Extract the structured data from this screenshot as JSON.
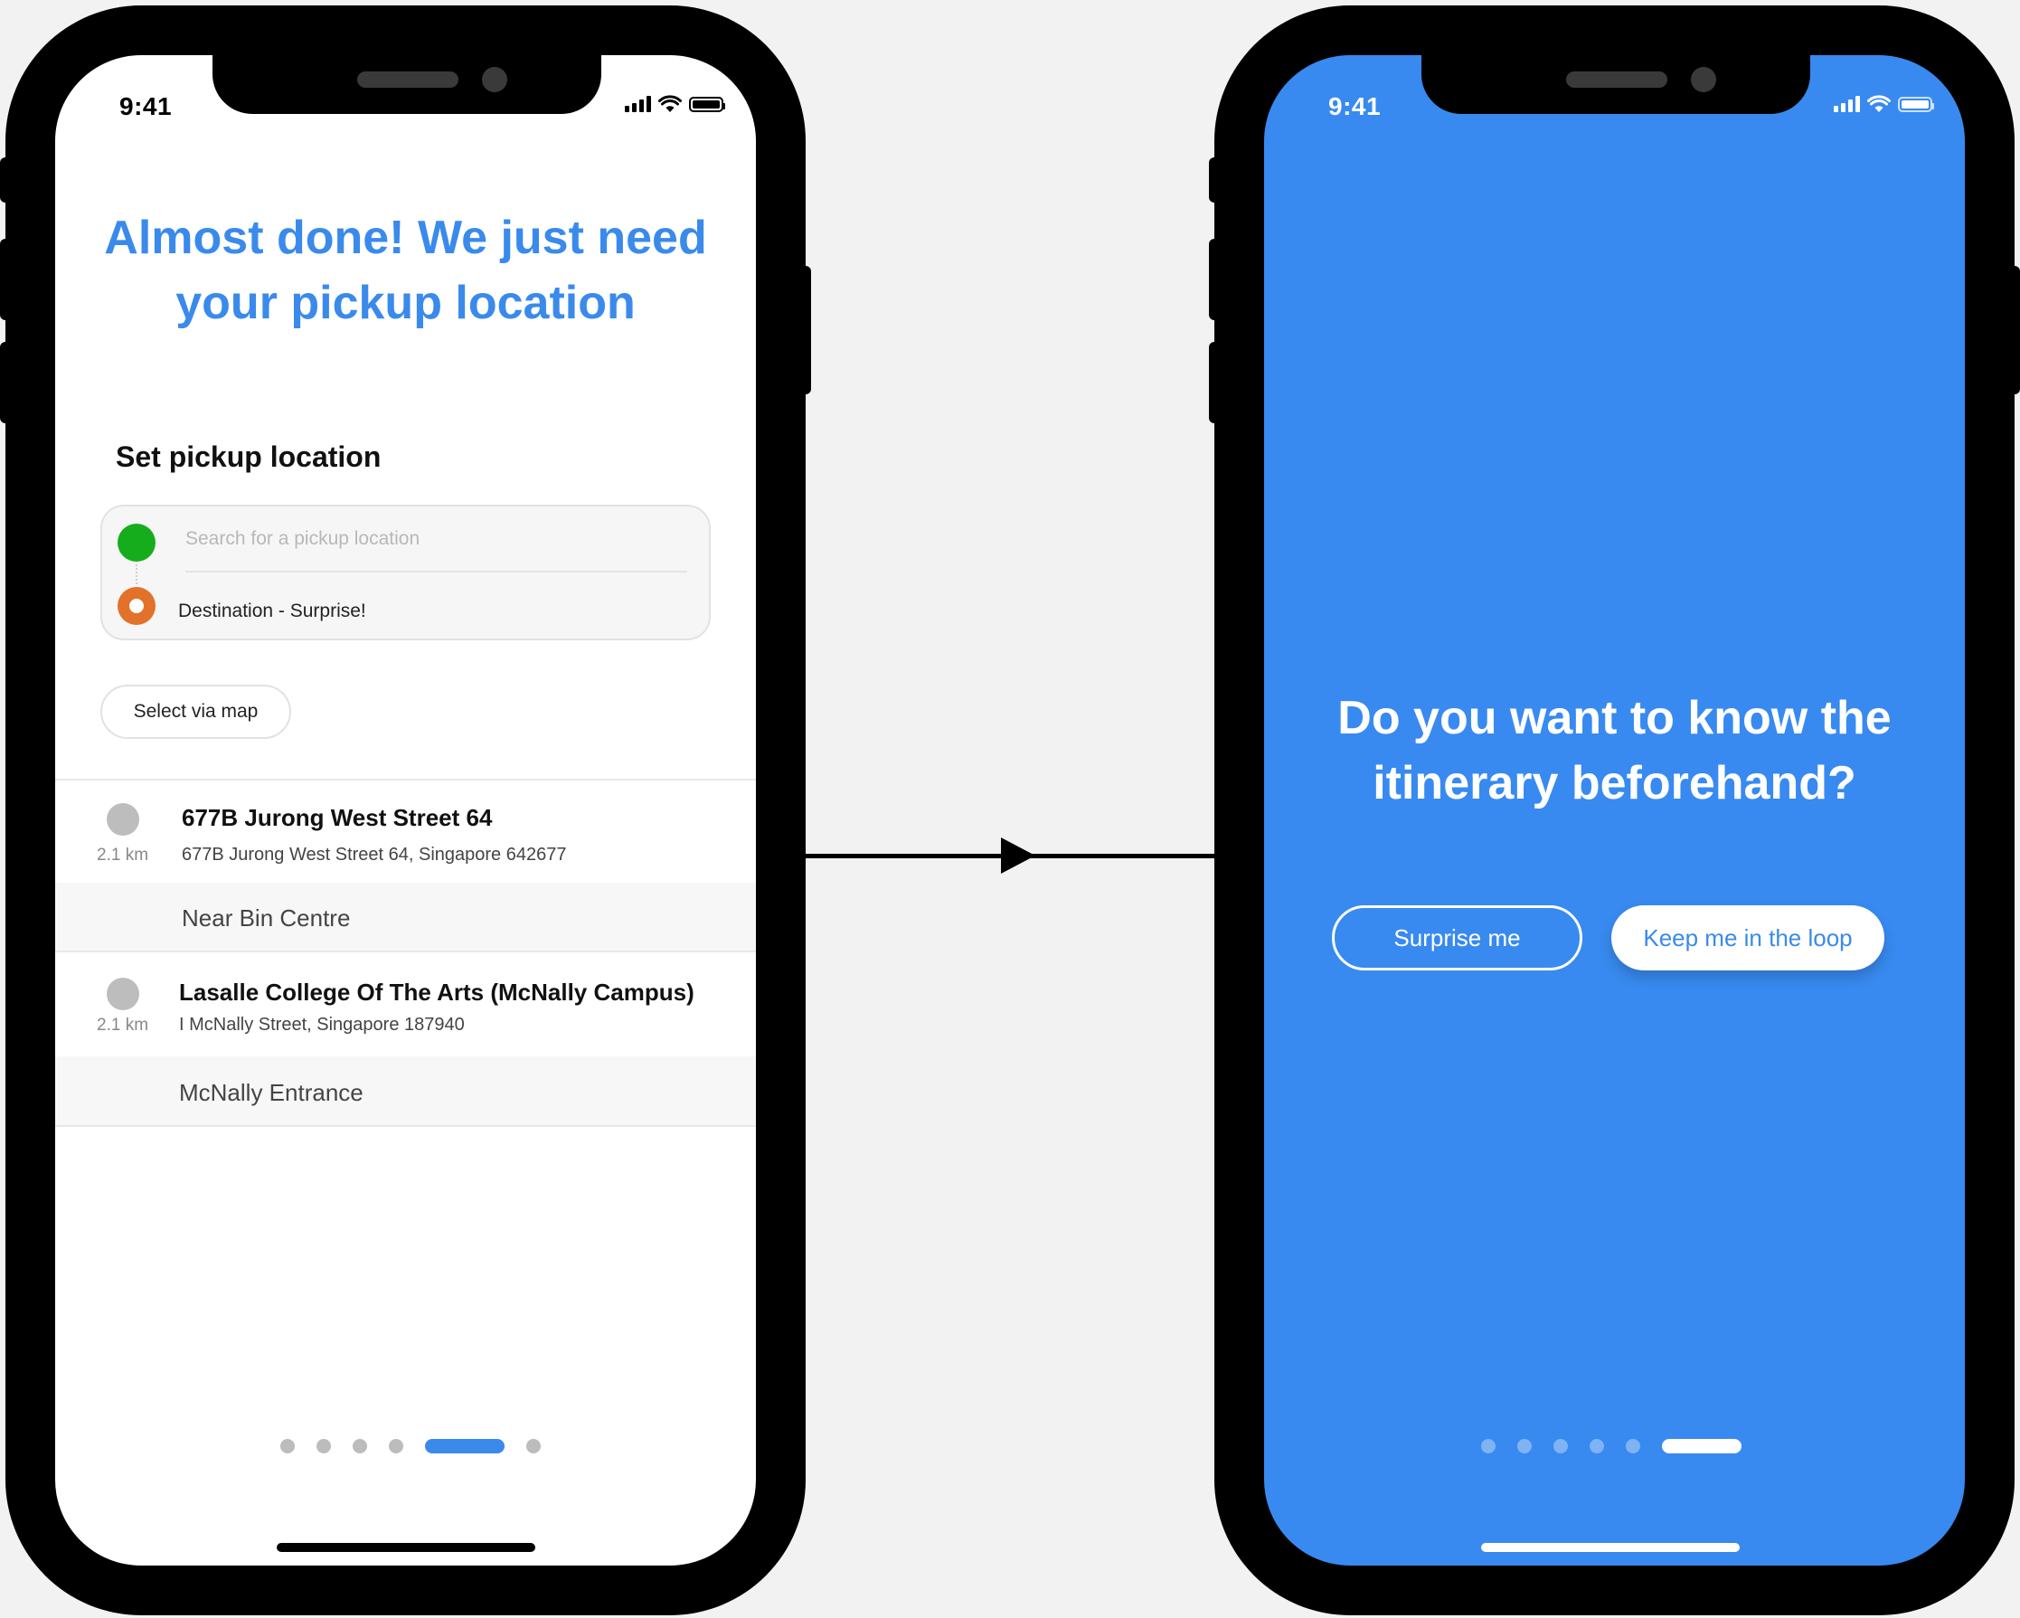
{
  "screen_left": {
    "status_time": "9:41",
    "headline": "Almost done! We just need your pickup location",
    "section_title": "Set pickup location",
    "search": {
      "placeholder": "Search for a pickup location",
      "value": ""
    },
    "destination_label": "Destination - Surprise!",
    "select_map_label": "Select via map",
    "results": [
      {
        "name": "677B Jurong West Street 64",
        "distance": "2.1 km",
        "address": "677B Jurong West Street 64, Singapore 642677",
        "sub_location": "Near Bin Centre"
      },
      {
        "name": "Lasalle College Of The Arts (McNally Campus)",
        "distance": "2.1 km",
        "address": "I McNally Street, Singapore 187940",
        "sub_location": "McNally Entrance"
      }
    ],
    "pager": {
      "total": 6,
      "active_index": 4
    }
  },
  "screen_right": {
    "status_time": "9:41",
    "question": "Do you want to know the itinerary beforehand?",
    "surprise_button": "Surprise me",
    "loop_button": "Keep me in the loop",
    "pager": {
      "total": 6,
      "active_index": 5
    }
  },
  "colors": {
    "accent_blue": "#3a8aec",
    "screen_blue": "#388af0",
    "pickup_green": "#16ad1c",
    "destination_orange": "#e2722a",
    "canvas": "#f2f2f2"
  },
  "icons": [
    "signal-icon",
    "wifi-icon",
    "battery-icon",
    "pickup-dot-icon",
    "destination-dot-icon",
    "location-pin-icon",
    "arrow-right-icon"
  ]
}
